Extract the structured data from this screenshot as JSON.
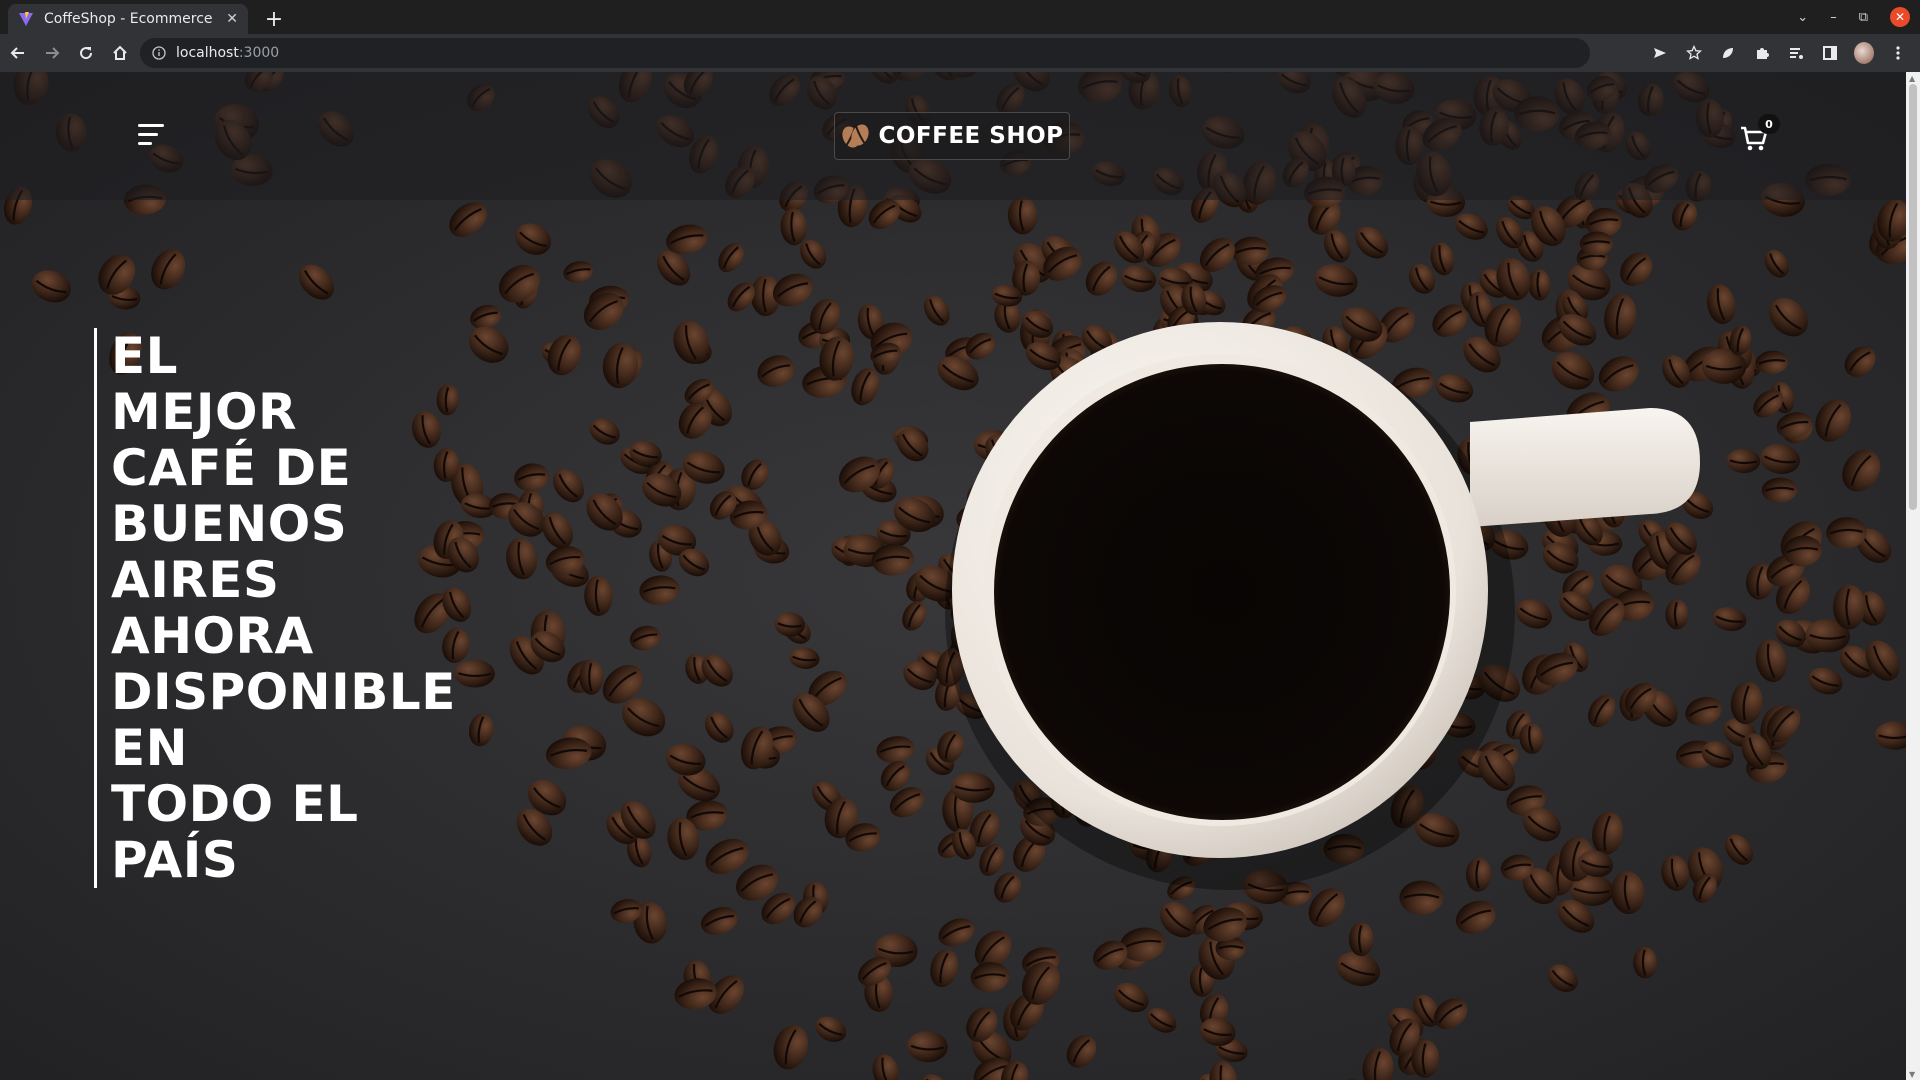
{
  "browser": {
    "tab_title": "CoffeShop - Ecommerce",
    "url_host": "localhost",
    "url_port": ":3000"
  },
  "site": {
    "logo_text": "COFFEE SHOP",
    "cart_count": "0",
    "hero_lines": [
      "EL",
      "MEJOR",
      "CAFÉ DE",
      "BUENOS",
      "AIRES",
      "AHORA",
      "DISPONIBLE",
      "EN",
      "TODO EL",
      "PAÍS"
    ]
  },
  "icons": {
    "menu": "hamburger-menu-icon",
    "logo": "coffee-bean-icon",
    "cart": "shopping-cart-icon"
  },
  "colors": {
    "page_background": "#2d2d30",
    "header_background": "#1e1e20",
    "hero_text": "#ffffff",
    "coffee_bean": "#3b2418",
    "cup": "#f1ece6",
    "coffee": "#0b0706"
  }
}
